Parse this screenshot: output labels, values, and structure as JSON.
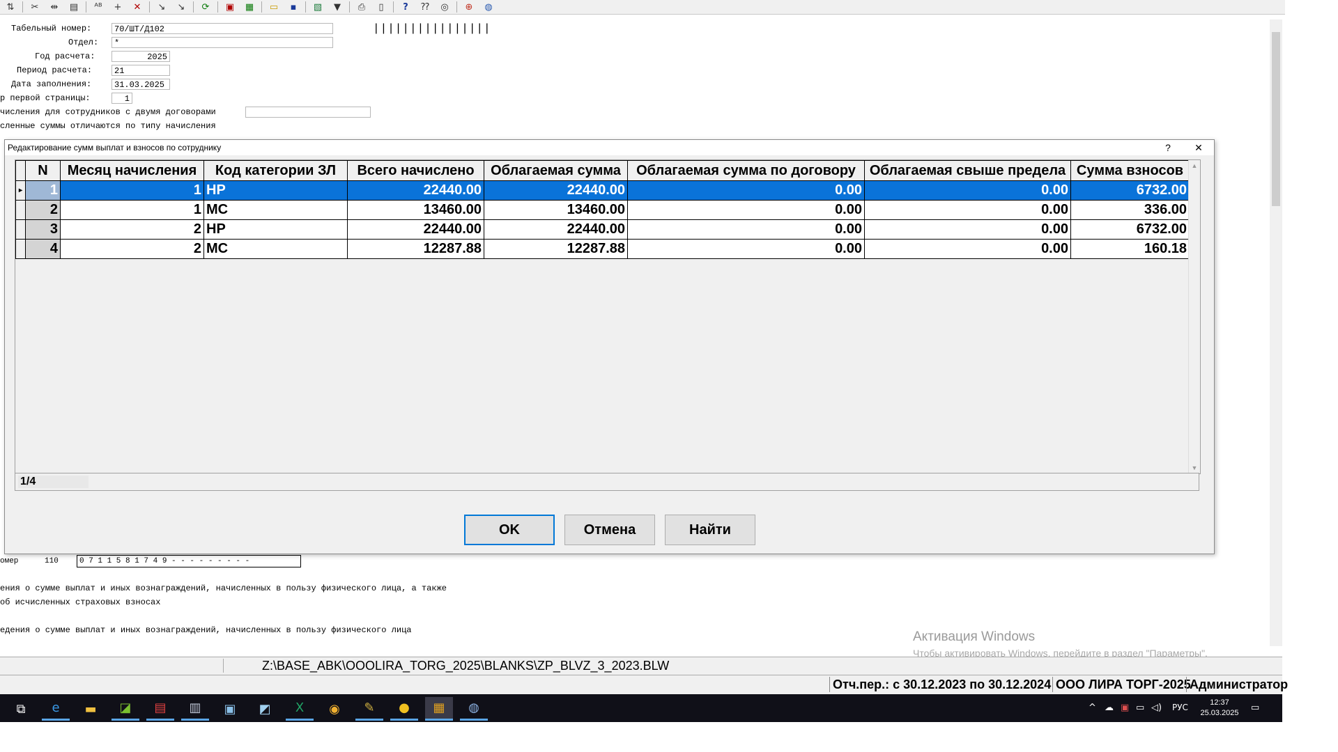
{
  "toolbar": {
    "icons": [
      "sort-icon",
      "cut-icon",
      "merge-icon",
      "paste-icon",
      "abc-icon",
      "add-icon",
      "delete-icon",
      "pick-icon",
      "pick2-icon",
      "refresh-icon",
      "pdf-icon",
      "calc-icon",
      "open-folder-icon",
      "save-icon",
      "excel-icon",
      "filter-icon",
      "print-icon",
      "preview-icon",
      "help-icon",
      "help-context-icon",
      "compass-icon",
      "lifebuoy-icon",
      "globe-icon"
    ]
  },
  "form": {
    "tab_number_label": "Табельный номер:",
    "tab_number_value": "70/ШТ/Д102",
    "dept_label": "Отдел:",
    "dept_value": "*",
    "year_label": "Год расчета:",
    "year_value": "2025",
    "period_label": "Период расчета:",
    "period_value": "21",
    "fill_date_label": "Дата заполнения:",
    "fill_date_value": "31.03.2025",
    "first_page_label": "р первой страницы:",
    "first_page_value": "1",
    "two_contracts_label": "числения для сотрудников с двумя договорами",
    "sums_differ_label": "сленные суммы отличаются по типу начисления",
    "barcode": "||||||||||||||||",
    "number_label": "омер",
    "number_value": "110",
    "number_boxes": "0 7   1 1   5 8 1 7 4 9 - - - - - - - - -",
    "info_line1": "ения о сумме выплат и иных вознаграждений, начисленных в пользу физического лица, а также",
    "info_line2": "об исчисленных страховых взносах",
    "info_line3": "едения о сумме выплат и иных вознаграждений, начисленных в пользу физического лица"
  },
  "dialog": {
    "title": "Редактирование сумм выплат и взносов по сотруднику",
    "help_label": "?",
    "close_label": "✕",
    "columns": [
      "N",
      "Месяц начисления",
      "Код категории ЗЛ",
      "Всего начислено",
      "Облагаемая сумма",
      "Облагаемая сумма по договору",
      "Облагаемая свыше предела",
      "Сумма взносов"
    ],
    "rows": [
      {
        "n": "1",
        "month": "1",
        "code": "НР",
        "total": "22440.00",
        "taxable": "22440.00",
        "contract": "0.00",
        "over": "0.00",
        "contrib": "6732.00"
      },
      {
        "n": "2",
        "month": "1",
        "code": "МС",
        "total": "13460.00",
        "taxable": "13460.00",
        "contract": "0.00",
        "over": "0.00",
        "contrib": "336.00"
      },
      {
        "n": "3",
        "month": "2",
        "code": "НР",
        "total": "22440.00",
        "taxable": "22440.00",
        "contract": "0.00",
        "over": "0.00",
        "contrib": "6732.00"
      },
      {
        "n": "4",
        "month": "2",
        "code": "МС",
        "total": "12287.88",
        "taxable": "12287.88",
        "contract": "0.00",
        "over": "0.00",
        "contrib": "160.18"
      }
    ],
    "record_counter": "1/4",
    "ok_label": "OK",
    "cancel_label": "Отмена",
    "find_label": "Найти"
  },
  "watermark": {
    "line1": "Активация Windows",
    "line2": "Чтобы активировать Windows, перейдите в раздел \"Параметры\"."
  },
  "status": {
    "path": "Z:\\BASE_ABK\\OOOLIRA_TORG_2025\\BLANKS\\ZP_BLVZ_3_2023.BLW",
    "period": "Отч.пер.: с 30.12.2023 по 30.12.2024",
    "company": "ООО ЛИРА ТОРГ-2025",
    "user": "Администратор"
  },
  "taskbar": {
    "lang": "РУС",
    "time": "12:37",
    "date": "25.03.2025"
  }
}
